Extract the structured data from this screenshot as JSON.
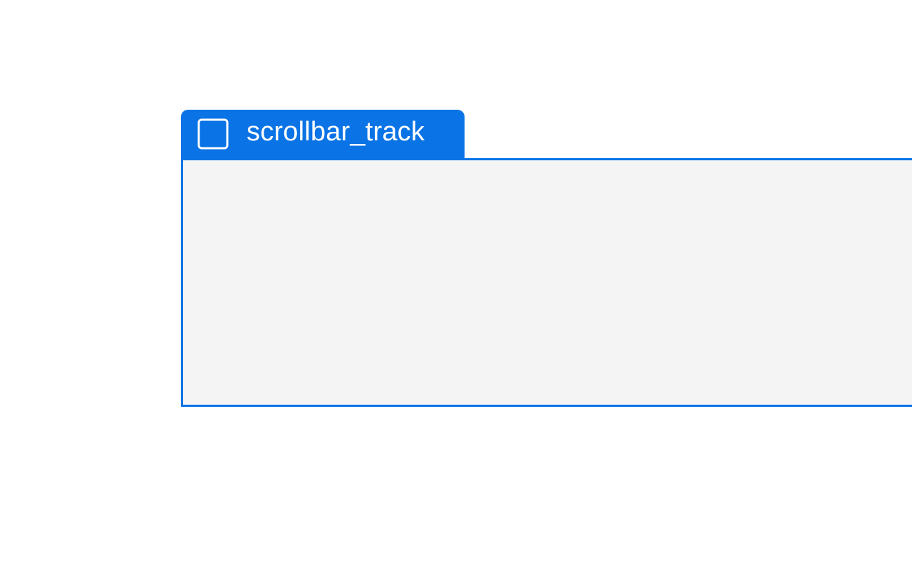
{
  "element": {
    "label": "scrollbar_track",
    "icon": "checkbox-square-icon"
  },
  "colors": {
    "accent": "#0a73e5",
    "track_fill": "#f4f4f4",
    "label_text": "#ffffff",
    "background": "#ffffff"
  }
}
